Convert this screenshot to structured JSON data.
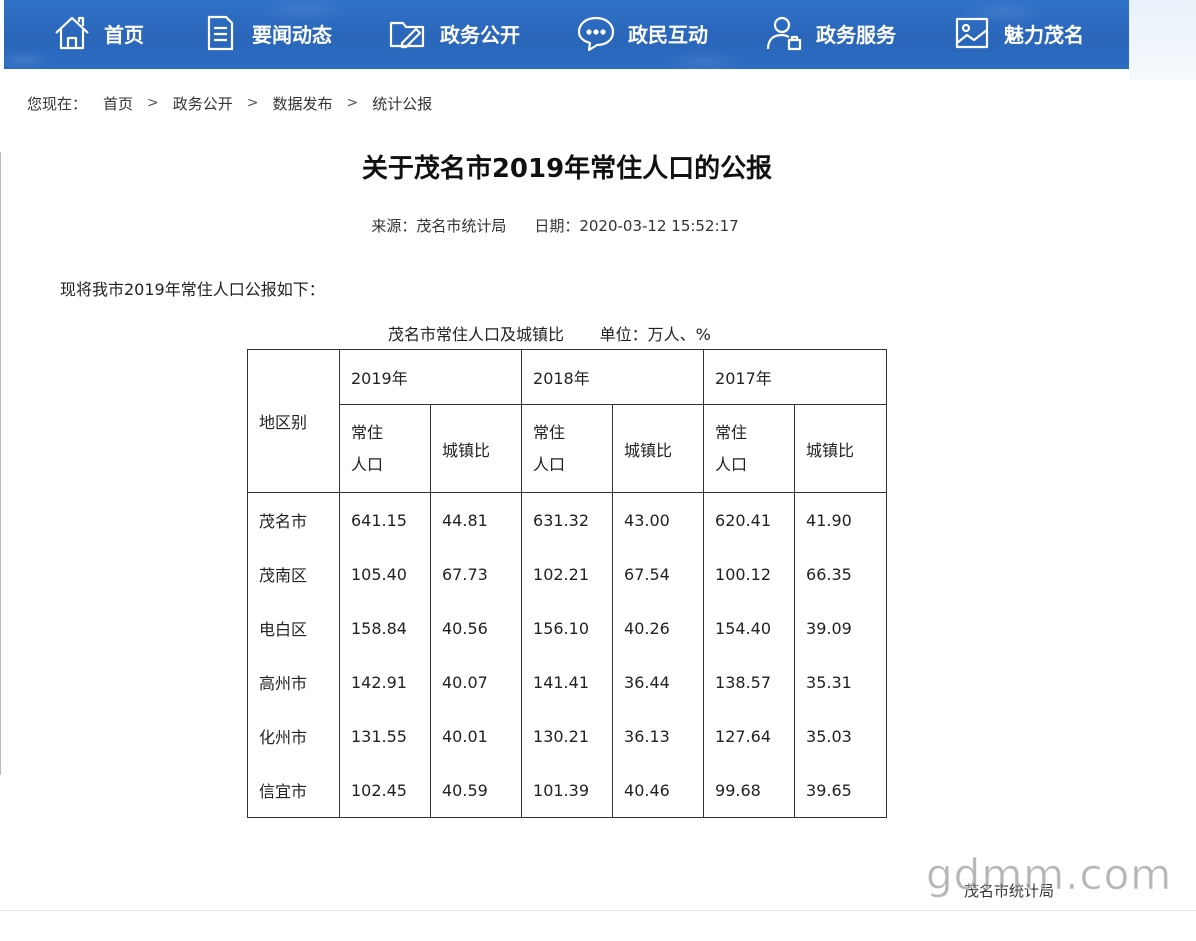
{
  "nav": {
    "items": [
      {
        "label": "首页",
        "icon": "home-icon"
      },
      {
        "label": "要闻动态",
        "icon": "document-icon"
      },
      {
        "label": "政务公开",
        "icon": "folder-icon"
      },
      {
        "label": "政民互动",
        "icon": "chat-icon"
      },
      {
        "label": "政务服务",
        "icon": "user-service-icon"
      },
      {
        "label": "魅力茂名",
        "icon": "picture-icon"
      }
    ]
  },
  "breadcrumb": {
    "lead": "您现在：",
    "items": [
      "首页",
      "政务公开",
      "数据发布",
      "统计公报"
    ],
    "separator": ">"
  },
  "article": {
    "title": "关于茂名市2019年常住人口的公报",
    "source": "来源：茂名市统计局",
    "date": "日期：2020-03-12 15:52:17",
    "intro": "现将我市2019年常住人口公报如下：",
    "table_caption": "茂名市常住人口及城镇比       单位：万人、%",
    "table": {
      "region_header": "地区别",
      "years": [
        "2019年",
        "2018年",
        "2017年"
      ],
      "sub_pop_line1": "常住",
      "sub_pop_line2": "人口",
      "sub_urban": "城镇比",
      "rows": [
        {
          "region": "茂名市",
          "values": [
            "641.15",
            "44.81",
            "631.32",
            "43.00",
            "620.41",
            "41.90"
          ]
        },
        {
          "region": "茂南区",
          "values": [
            "105.40",
            "67.73",
            "102.21",
            "67.54",
            "100.12",
            "66.35"
          ]
        },
        {
          "region": "电白区",
          "values": [
            "158.84",
            "40.56",
            "156.10",
            "40.26",
            "154.40",
            "39.09"
          ]
        },
        {
          "region": "高州市",
          "values": [
            "142.91",
            "40.07",
            "141.41",
            "36.44",
            "138.57",
            "35.31"
          ]
        },
        {
          "region": "化州市",
          "values": [
            "131.55",
            "40.01",
            "130.21",
            "36.13",
            "127.64",
            "35.03"
          ]
        },
        {
          "region": "信宜市",
          "values": [
            "102.45",
            "40.59",
            "101.39",
            "40.46",
            "99.68",
            "39.65"
          ]
        }
      ]
    },
    "signature": "茂名市统计局"
  },
  "watermark": "gdmm.com",
  "colors": {
    "nav_bg": "#2b6cc2",
    "text": "#222222"
  }
}
